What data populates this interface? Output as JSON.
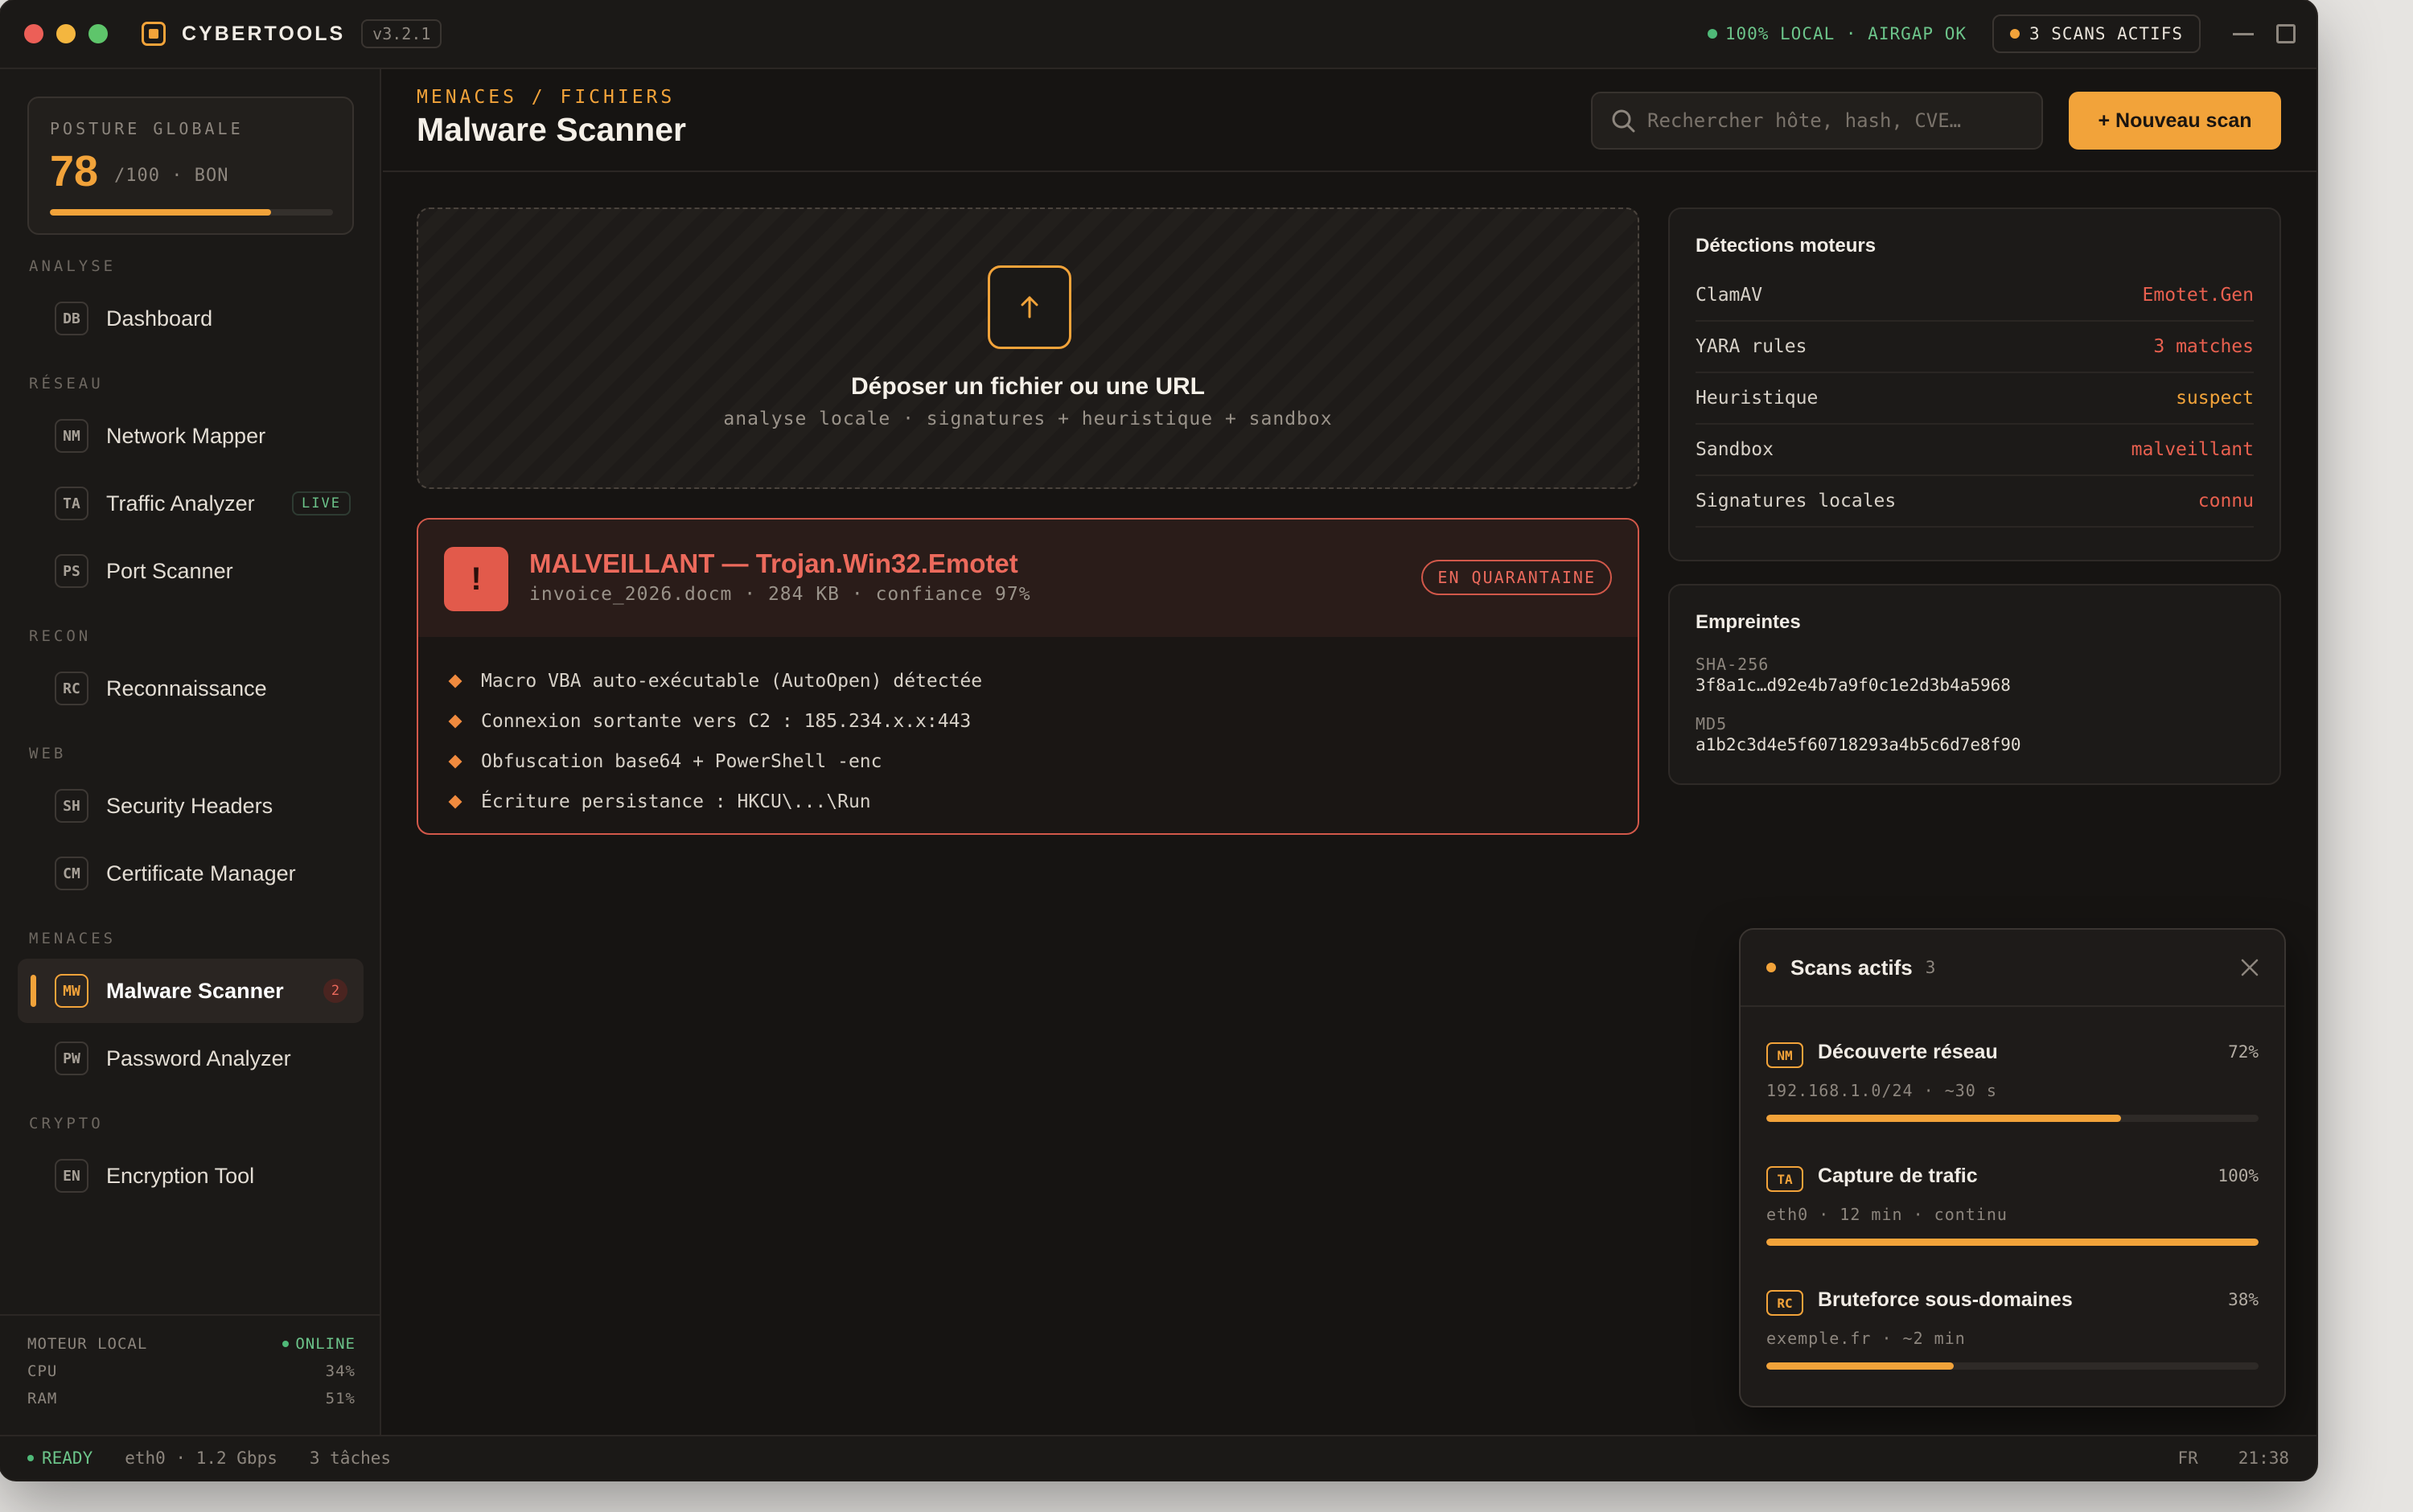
{
  "titlebar": {
    "app_name": "CYBERTOOLS",
    "version": "v3.2.1",
    "status": "100% LOCAL · AIRGAP OK",
    "scans_label": "3 SCANS ACTIFS"
  },
  "sidebar": {
    "posture": {
      "label": "POSTURE GLOBALE",
      "score": "78",
      "suffix": "/100 · BON",
      "fill": 0.78
    },
    "sections": {
      "analyse": "ANALYSE",
      "reseau": "RÉSEAU",
      "recon": "RECON",
      "web": "WEB",
      "menaces": "MENACES",
      "crypto": "CRYPTO"
    },
    "items": {
      "dashboard": {
        "abbr": "DB",
        "label": "Dashboard"
      },
      "network_mapper": {
        "abbr": "NM",
        "label": "Network Mapper"
      },
      "traffic_analyzer": {
        "abbr": "TA",
        "label": "Traffic Analyzer",
        "tag": "LIVE"
      },
      "port_scanner": {
        "abbr": "PS",
        "label": "Port Scanner"
      },
      "reconnaissance": {
        "abbr": "RC",
        "label": "Reconnaissance"
      },
      "security_headers": {
        "abbr": "SH",
        "label": "Security Headers"
      },
      "certificate_manager": {
        "abbr": "CM",
        "label": "Certificate Manager"
      },
      "malware_scanner": {
        "abbr": "MW",
        "label": "Malware Scanner",
        "count": "2"
      },
      "password_analyzer": {
        "abbr": "PW",
        "label": "Password Analyzer"
      },
      "encryption_tool": {
        "abbr": "EN",
        "label": "Encryption Tool"
      }
    },
    "engine": {
      "label": "MOTEUR LOCAL",
      "status": "ONLINE",
      "cpu_label": "CPU",
      "cpu": "34%",
      "ram_label": "RAM",
      "ram": "51%"
    }
  },
  "header": {
    "breadcrumb": "MENACES / FICHIERS",
    "title": "Malware Scanner",
    "search_placeholder": "Rechercher hôte, hash, CVE…",
    "new_scan": "+ Nouveau scan"
  },
  "dropzone": {
    "icon": "upload-arrow-icon",
    "title": "Déposer un fichier ou une URL",
    "subtitle": "analyse locale · signatures + heuristique + sandbox"
  },
  "alert": {
    "icon": "!",
    "title": "MALVEILLANT — Trojan.Win32.Emotet",
    "subtitle": "invoice_2026.docm · 284 KB · confiance 97%",
    "badge": "EN QUARANTAINE",
    "findings": [
      "Macro VBA auto-exécutable (AutoOpen) détectée",
      "Connexion sortante vers C2 : 185.234.x.x:443",
      "Obfuscation base64 + PowerShell -enc",
      "Écriture persistance : HKCU\\...\\Run"
    ]
  },
  "detections": {
    "title": "Détections moteurs",
    "rows": [
      {
        "engine": "ClamAV",
        "result": "Emotet.Gen",
        "color": "#e8604f"
      },
      {
        "engine": "YARA rules",
        "result": "3 matches",
        "color": "#e8604f"
      },
      {
        "engine": "Heuristique",
        "result": "suspect",
        "color": "#f2a33a"
      },
      {
        "engine": "Sandbox",
        "result": "malveillant",
        "color": "#e8604f"
      },
      {
        "engine": "Signatures locales",
        "result": "connu",
        "color": "#e8604f"
      }
    ]
  },
  "fingerprints": {
    "title": "Empreintes",
    "sha256_label": "SHA-256",
    "sha256": "3f8a1c…d92e4b7a9f0c1e2d3b4a5968",
    "md5_label": "MD5",
    "md5": "a1b2c3d4e5f60718293a4b5c6d7e8f90"
  },
  "active_scans": {
    "title": "Scans actifs",
    "count": "3",
    "items": [
      {
        "tag": "NM",
        "name": "Découverte réseau",
        "pct": "72%",
        "meta": "192.168.1.0/24 · ~30 s",
        "progress": 0.72
      },
      {
        "tag": "TA",
        "name": "Capture de trafic",
        "pct": "100%",
        "meta": "eth0 · 12 min · continu",
        "progress": 1.0
      },
      {
        "tag": "RC",
        "name": "Bruteforce sous-domaines",
        "pct": "38%",
        "meta": "exemple.fr · ~2 min",
        "progress": 0.38
      }
    ]
  },
  "statusbar": {
    "ready": "READY",
    "iface": "eth0 · 1.2 Gbps",
    "tasks": "3 tâches",
    "lang": "FR",
    "time": "21:38"
  },
  "colors": {
    "accent": "#f2a33a",
    "danger": "#e8604f",
    "ok": "#4fb978"
  }
}
